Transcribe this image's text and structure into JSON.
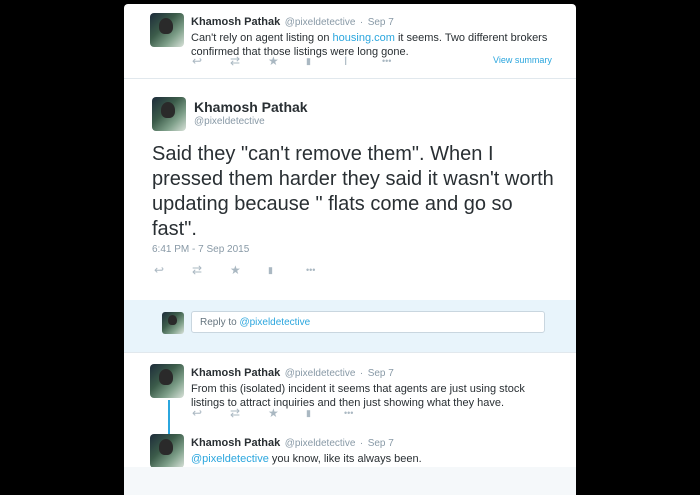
{
  "tweets": {
    "t1": {
      "name": "Khamosh Pathak",
      "handle": "@pixeldetective",
      "sep": "·",
      "date": "Sep 7",
      "text_pre": "Can't rely on agent listing on ",
      "text_link": "housing.com",
      "text_post": " it seems. Two different brokers confirmed that those listings were long gone.",
      "view_summary": "View summary"
    },
    "main": {
      "name": "Khamosh Pathak",
      "handle": "@pixeldetective",
      "text": "Said they \"can't remove them\". When I pressed them harder they said it wasn't worth updating because \" flats come and go so  fast\".",
      "timestamp": "6:41 PM - 7 Sep 2015"
    },
    "reply_placeholder_pre": "Reply to ",
    "reply_placeholder_link": "@pixeldetective",
    "t2": {
      "name": "Khamosh Pathak",
      "handle": "@pixeldetective",
      "sep": "·",
      "date": "Sep 7",
      "text": "From this (isolated) incident it seems that agents are just using stock listings to attract inquiries and then just showing what they have."
    },
    "t3": {
      "name": "Khamosh Pathak",
      "handle": "@pixeldetective",
      "sep": "·",
      "date": "Sep 7",
      "text_link": "@pixeldetective",
      "text_post": " you know, like its always been."
    }
  },
  "icons": {
    "reply": "↩",
    "retweet": "⇄",
    "favorite": "★",
    "stats": "▮",
    "pipe": "I",
    "more": "•••"
  },
  "colors": {
    "link": "#2ba6de",
    "muted": "#8899a6",
    "reply_bg": "#e8f4fb"
  }
}
